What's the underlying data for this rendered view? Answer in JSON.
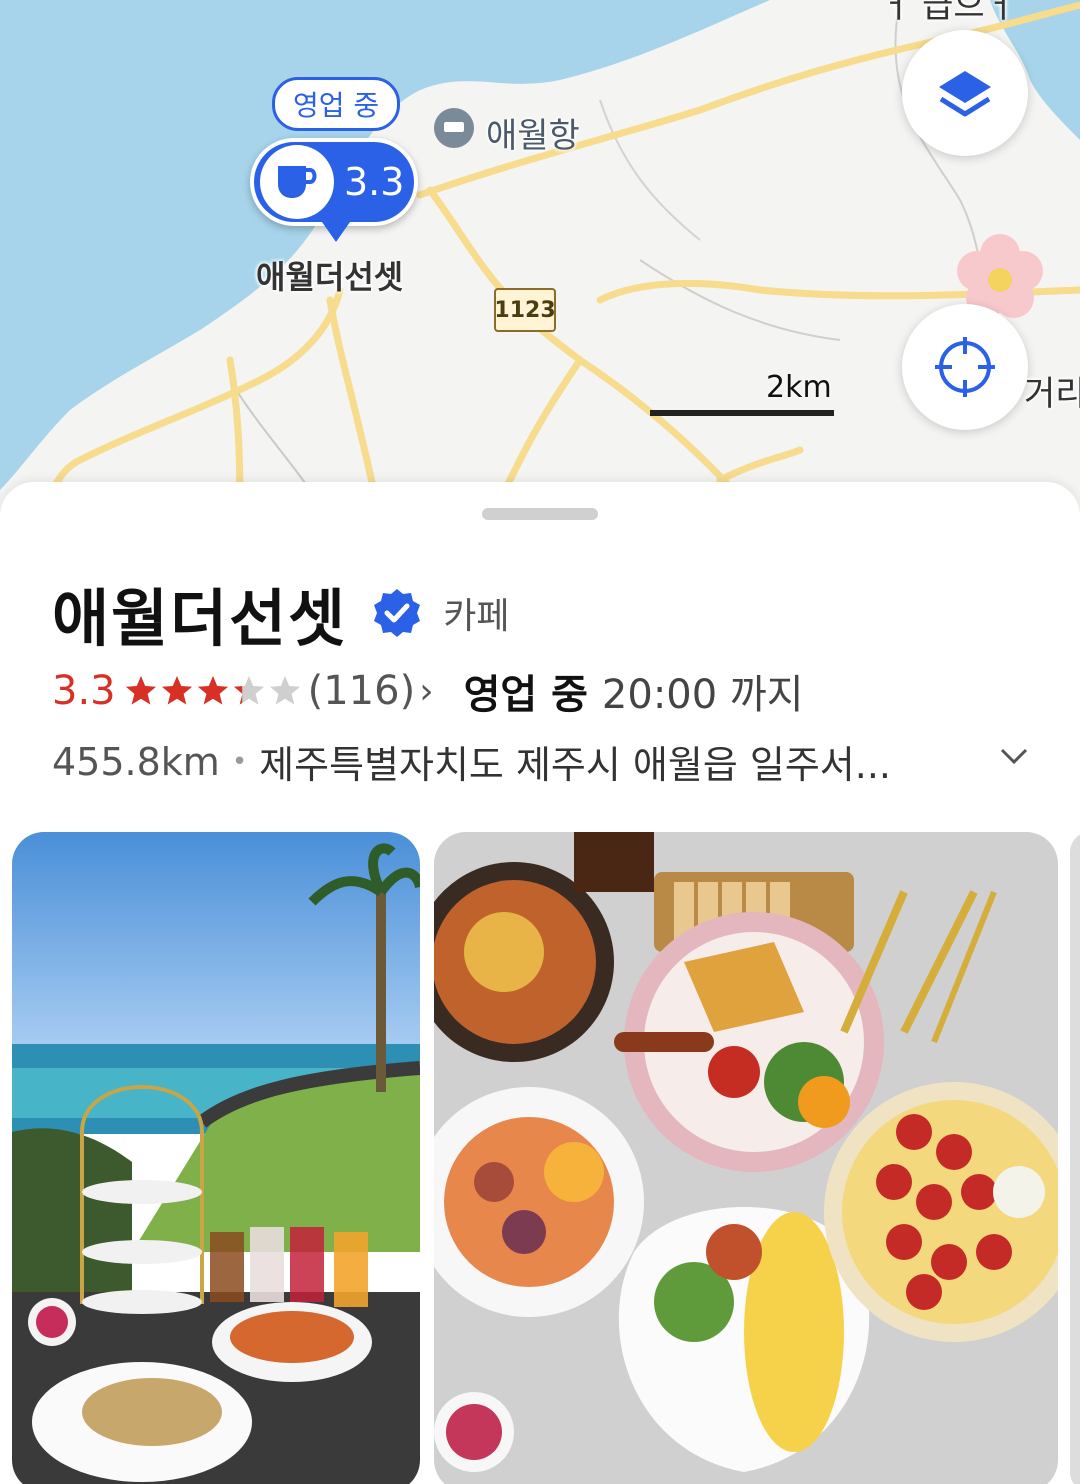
{
  "map": {
    "pin_status": "영업 중",
    "pin_rating": "3.3",
    "pin_label": "애월더선셋",
    "port_label": "애월항",
    "road_number": "1123",
    "scale": "2km",
    "partial_label": "거리",
    "layers_icon": "layers-icon",
    "location_icon": "crosshair-icon"
  },
  "place": {
    "name": "애월더선셋",
    "category": "카페",
    "verified": true,
    "rating": "3.3",
    "stars": 3.3,
    "review_count": "(116)",
    "status": "영업 중",
    "hours": "20:00 까지",
    "distance": "455.8km",
    "address": "제주특별자치도 제주시 애월읍 일주서..."
  },
  "colors": {
    "accent": "#2b61e6",
    "rating": "#d93025",
    "sea": "#a7d4ea",
    "land": "#f4f4f2",
    "road": "#f6dc8c"
  },
  "photos": [
    {
      "name": "ocean-view-brunch-photo"
    },
    {
      "name": "brunch-spread-photo"
    }
  ]
}
